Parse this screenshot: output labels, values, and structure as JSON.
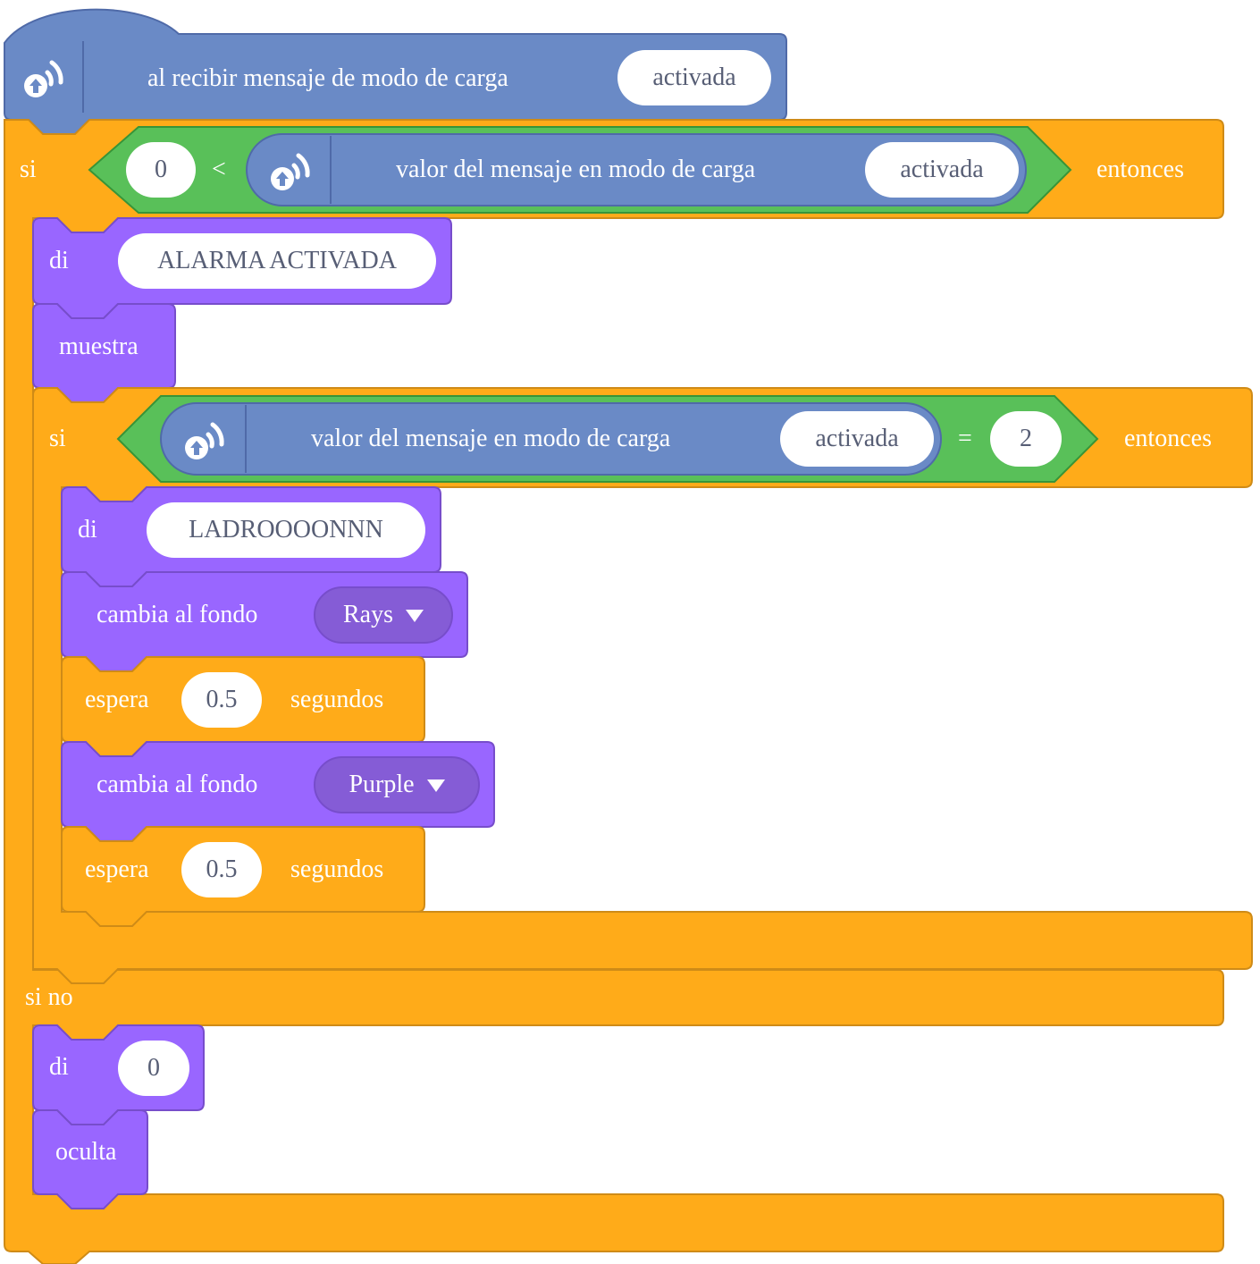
{
  "hat": {
    "label": "al recibir mensaje de modo de carga",
    "message": "activada",
    "icon": "wireless-broadcast-icon"
  },
  "if_outer": {
    "keyword": "si",
    "then": "entonces",
    "else": "si no",
    "condition": {
      "left": "0",
      "operator": "<",
      "reporter_label": "valor del mensaje en modo de carga",
      "reporter_message": "activada"
    }
  },
  "say_alarm": {
    "label": "di",
    "text": "ALARMA ACTIVADA"
  },
  "show": {
    "label": "muestra"
  },
  "if_inner": {
    "keyword": "si",
    "then": "entonces",
    "condition": {
      "reporter_label": "valor del mensaje en modo de carga",
      "reporter_message": "activada",
      "operator": "=",
      "right": "2"
    }
  },
  "say_thief": {
    "label": "di",
    "text": "LADROOOONNN"
  },
  "switch_backdrop_1": {
    "label": "cambia al fondo",
    "value": "Rays"
  },
  "wait_1": {
    "label": "espera",
    "value": "0.5",
    "unit": "segundos"
  },
  "switch_backdrop_2": {
    "label": "cambia al fondo",
    "value": "Purple"
  },
  "wait_2": {
    "label": "espera",
    "value": "0.5",
    "unit": "segundos"
  },
  "say_zero": {
    "label": "di",
    "text": "0"
  },
  "hide": {
    "label": "oculta"
  },
  "colors": {
    "extension": "#6a8ac6",
    "extension_border": "#4f6aa8",
    "control": "#ffab19",
    "control_border": "#cf8b17",
    "operators": "#59c059",
    "operators_border": "#389438",
    "looks": "#9966ff",
    "looks_border": "#774dcb",
    "looks_dropdown": "#855cd6"
  }
}
